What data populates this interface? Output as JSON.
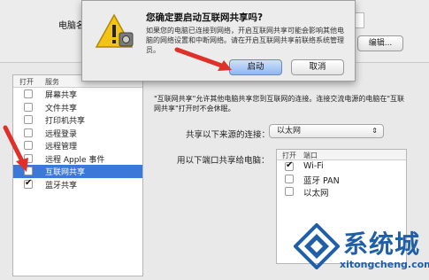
{
  "window": {
    "hostname_label": "电脑名",
    "edit_button": "编辑..."
  },
  "services": {
    "header_on": "打开",
    "header_service": "服务",
    "items": [
      {
        "label": "屏幕共享",
        "checked": false,
        "selected": false
      },
      {
        "label": "文件共享",
        "checked": false,
        "selected": false
      },
      {
        "label": "打印机共享",
        "checked": false,
        "selected": false
      },
      {
        "label": "远程登录",
        "checked": false,
        "selected": false
      },
      {
        "label": "远程管理",
        "checked": false,
        "selected": false
      },
      {
        "label": "远程 Apple 事件",
        "checked": false,
        "selected": false
      },
      {
        "label": "互联网共享",
        "checked": false,
        "selected": true
      },
      {
        "label": "蓝牙共享",
        "checked": true,
        "selected": false
      }
    ]
  },
  "panel": {
    "description": "\"互联网共享\"允许其他电脑共享您到互联网的连接。连接交流电源的电脑在\"互联网共享\"打开时不会休眠。",
    "share_from_label": "共享以下来源的连接：",
    "share_from_value": "以太网",
    "share_to_label": "用以下端口共享给电脑：",
    "ports_header_on": "打开",
    "ports_header_port": "端口",
    "ports": [
      {
        "label": "Wi-Fi",
        "checked": true
      },
      {
        "label": "蓝牙 PAN",
        "checked": false
      },
      {
        "label": "以太网",
        "checked": false
      }
    ]
  },
  "dialog": {
    "title": "您确定要启动互联网共享吗?",
    "message": "如果您的电脑已连接到网络，开启互联网共享可能会影响其他电脑的网络设置和中断网络。请在开启互联网共享前联络系统管理员。",
    "start_button": "启动",
    "cancel_button": "取消"
  },
  "watermark": {
    "brand": "系统城",
    "url": "xitongcheng.com"
  },
  "colors": {
    "selection": "#3c78d8",
    "arrow": "#e0302a",
    "watermark": "#1e5fa8"
  }
}
